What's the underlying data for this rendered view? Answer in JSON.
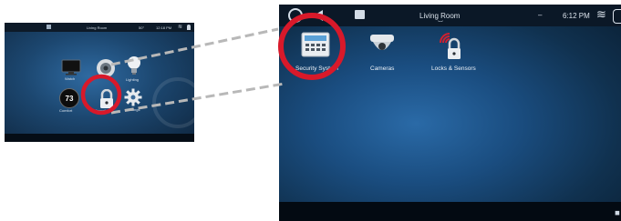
{
  "small_screen": {
    "header": {
      "room": "Living Room",
      "temperature": "50°",
      "time": "12:18 PM"
    },
    "tiles": [
      {
        "id": "watch",
        "label": "Watch",
        "icon": "tv-icon"
      },
      {
        "id": "listen",
        "label": "",
        "icon": "speaker-icon"
      },
      {
        "id": "lighting",
        "label": "Lighting",
        "icon": "lightbulb-icon"
      },
      {
        "id": "comfort",
        "label": "Comfort",
        "value": "73",
        "icon": "thermostat-icon"
      },
      {
        "id": "security",
        "label": "Security",
        "icon": "padlock-icon"
      },
      {
        "id": "settings",
        "label": "Settings",
        "icon": "gear-icon"
      }
    ]
  },
  "big_screen": {
    "header": {
      "room": "Living Room",
      "time": "6:12 PM",
      "separator": "–"
    },
    "tiles": [
      {
        "id": "security_system",
        "label": "Security System",
        "icon": "keypad-icon"
      },
      {
        "id": "cameras",
        "label": "Cameras",
        "icon": "dome-camera-icon"
      },
      {
        "id": "locks_sensors",
        "label": "Locks & Sensors",
        "icon": "wireless-lock-icon"
      }
    ]
  },
  "annotations": {
    "highlight_color": "#d8192a",
    "connector_color": "#b8b8b8"
  }
}
